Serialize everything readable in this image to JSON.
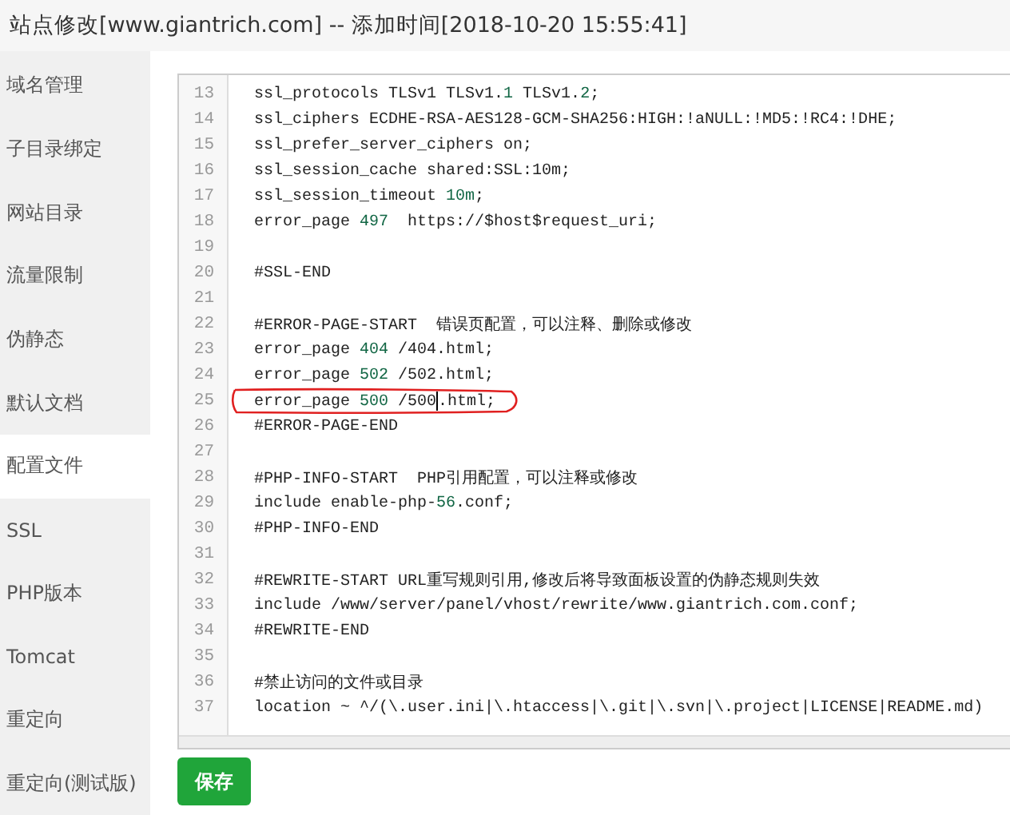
{
  "window": {
    "title": "站点修改[www.giantrich.com] -- 添加时间[2018-10-20 15:55:41]"
  },
  "sidebar": {
    "items": [
      {
        "label": "域名管理",
        "selected": false
      },
      {
        "label": "子目录绑定",
        "selected": false
      },
      {
        "label": "网站目录",
        "selected": false
      },
      {
        "label": "流量限制",
        "selected": false
      },
      {
        "label": "伪静态",
        "selected": false
      },
      {
        "label": "默认文档",
        "selected": false
      },
      {
        "label": "配置文件",
        "selected": true
      },
      {
        "label": "SSL",
        "selected": false
      },
      {
        "label": "PHP版本",
        "selected": false
      },
      {
        "label": "Tomcat",
        "selected": false
      },
      {
        "label": "重定向",
        "selected": false
      },
      {
        "label": "重定向(测试版)",
        "selected": false
      }
    ]
  },
  "editor": {
    "lines": [
      {
        "number": "13",
        "circled": false,
        "parts": [
          {
            "kind": "plain",
            "text": "ssl_protocols TLSv1 TLSv1."
          },
          {
            "kind": "number",
            "text": "1"
          },
          {
            "kind": "plain",
            "text": " TLSv1."
          },
          {
            "kind": "number",
            "text": "2"
          },
          {
            "kind": "plain",
            "text": ";"
          }
        ]
      },
      {
        "number": "14",
        "circled": false,
        "parts": [
          {
            "kind": "plain",
            "text": "ssl_ciphers ECDHE-RSA-AES128-GCM-SHA256:HIGH:!aNULL:!MD5:!RC4:!DHE;"
          }
        ]
      },
      {
        "number": "15",
        "circled": false,
        "parts": [
          {
            "kind": "plain",
            "text": "ssl_prefer_server_ciphers on;"
          }
        ]
      },
      {
        "number": "16",
        "circled": false,
        "parts": [
          {
            "kind": "plain",
            "text": "ssl_session_cache shared:SSL:10m;"
          }
        ]
      },
      {
        "number": "17",
        "circled": false,
        "parts": [
          {
            "kind": "plain",
            "text": "ssl_session_timeout "
          },
          {
            "kind": "number",
            "text": "10m"
          },
          {
            "kind": "plain",
            "text": ";"
          }
        ]
      },
      {
        "number": "18",
        "circled": false,
        "parts": [
          {
            "kind": "plain",
            "text": "error_page "
          },
          {
            "kind": "number",
            "text": "497"
          },
          {
            "kind": "plain",
            "text": "  https://$host$request_uri;"
          }
        ]
      },
      {
        "number": "19",
        "circled": false
      },
      {
        "number": "20",
        "circled": false,
        "parts": [
          {
            "kind": "plain",
            "text": "#SSL-END"
          }
        ]
      },
      {
        "number": "21",
        "circled": false
      },
      {
        "number": "22",
        "circled": false,
        "parts": [
          {
            "kind": "plain",
            "text": "#ERROR-PAGE-START  错误页配置，可以注释、删除或修改"
          }
        ]
      },
      {
        "number": "23",
        "circled": false,
        "parts": [
          {
            "kind": "plain",
            "text": "error_page "
          },
          {
            "kind": "number",
            "text": "404"
          },
          {
            "kind": "plain",
            "text": " /404.html;"
          }
        ]
      },
      {
        "number": "24",
        "circled": false,
        "parts": [
          {
            "kind": "plain",
            "text": "error_page "
          },
          {
            "kind": "number",
            "text": "502"
          },
          {
            "kind": "plain",
            "text": " /502.html;"
          }
        ]
      },
      {
        "number": "25",
        "circled": true,
        "parts": [
          {
            "kind": "plain",
            "text": "error_page "
          },
          {
            "kind": "number",
            "text": "500"
          },
          {
            "kind": "plain",
            "text": " /500"
          },
          {
            "kind": "cursor"
          },
          {
            "kind": "plain",
            "text": ".html;"
          }
        ]
      },
      {
        "number": "26",
        "circled": false,
        "parts": [
          {
            "kind": "plain",
            "text": "#ERROR-PAGE-END"
          }
        ]
      },
      {
        "number": "27",
        "circled": false
      },
      {
        "number": "28",
        "circled": false,
        "parts": [
          {
            "kind": "plain",
            "text": "#PHP-INFO-START  PHP引用配置，可以注释或修改"
          }
        ]
      },
      {
        "number": "29",
        "circled": false,
        "parts": [
          {
            "kind": "plain",
            "text": "include enable-php-"
          },
          {
            "kind": "number",
            "text": "56"
          },
          {
            "kind": "plain",
            "text": ".conf;"
          }
        ]
      },
      {
        "number": "30",
        "circled": false,
        "parts": [
          {
            "kind": "plain",
            "text": "#PHP-INFO-END"
          }
        ]
      },
      {
        "number": "31",
        "circled": false
      },
      {
        "number": "32",
        "circled": false,
        "parts": [
          {
            "kind": "plain",
            "text": "#REWRITE-START URL重写规则引用,修改后将导致面板设置的伪静态规则失效"
          }
        ]
      },
      {
        "number": "33",
        "circled": false,
        "parts": [
          {
            "kind": "plain",
            "text": "include /www/server/panel/vhost/rewrite/www.giantrich.com.conf;"
          }
        ]
      },
      {
        "number": "34",
        "circled": false,
        "parts": [
          {
            "kind": "plain",
            "text": "#REWRITE-END"
          }
        ]
      },
      {
        "number": "35",
        "circled": false
      },
      {
        "number": "36",
        "circled": false,
        "parts": [
          {
            "kind": "plain",
            "text": "#禁止访问的文件或目录"
          }
        ]
      },
      {
        "number": "37",
        "circled": false,
        "parts": [
          {
            "kind": "plain",
            "text": "location ~ ^/(\\.user.ini|\\.htaccess|\\.git|\\.svn|\\.project|LICENSE|README.md)"
          }
        ]
      }
    ]
  },
  "save_button": "保存"
}
